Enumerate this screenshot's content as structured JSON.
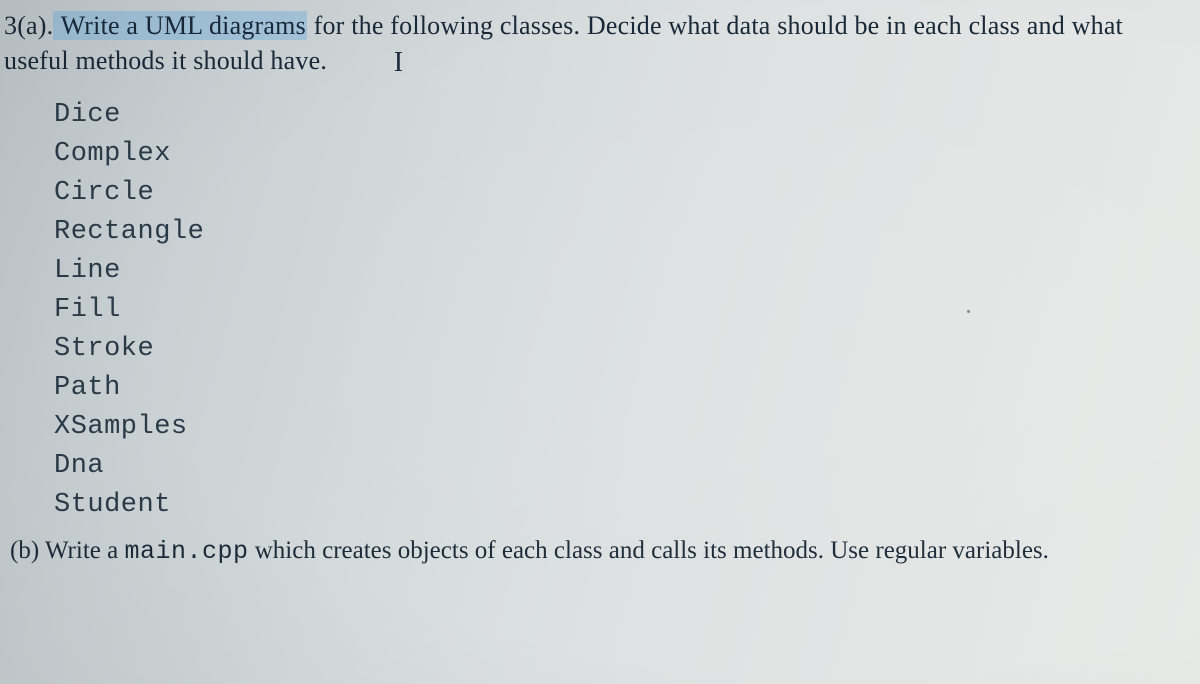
{
  "question_a": {
    "label": "3(a).",
    "highlighted_phrase": " Write a UML diagrams",
    "rest": " for the following classes. Decide what data should be in each class and what useful methods it should have.",
    "cursor_glyph": "I"
  },
  "classes": [
    "Dice",
    "Complex",
    "Circle",
    "Rectangle",
    "Line",
    "Fill",
    "Stroke",
    "Path",
    "XSamples",
    "Dna",
    "Student"
  ],
  "question_b": {
    "label": "(b) ",
    "before_code": "Write a ",
    "code": "main.cpp",
    "after_code": " which creates objects of each class and calls its methods. Use regular variables."
  }
}
